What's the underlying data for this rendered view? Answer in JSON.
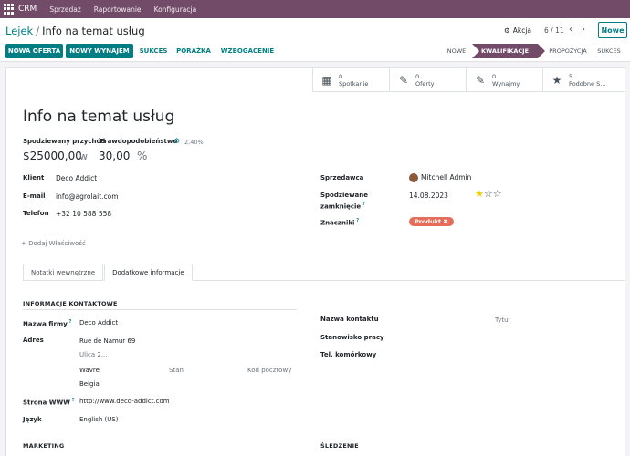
{
  "navbar": {
    "app_name": "CRM",
    "menus": [
      "Sprzedaż",
      "Raportowanie",
      "Konfiguracja"
    ]
  },
  "control_panel": {
    "breadcrumb_parent": "Lejek",
    "breadcrumb_current": "Info na temat usług",
    "action_label": "Akcja",
    "pager": "6 / 11",
    "new_button": "Nowe"
  },
  "statusbar": {
    "buttons": {
      "new_quote": "NOWA OFERTA",
      "new_rental": "NOWY WYNAJEM",
      "won": "SUKCES",
      "lost": "PORAŻKA",
      "enrich": "WZBOGACENIE"
    },
    "stages": [
      "NOWE",
      "KWALIFIKACJE",
      "PROPOZYCJA",
      "SUKCES"
    ],
    "active_stage": "KWALIFIKACJE"
  },
  "smart_buttons": [
    {
      "icon": "calendar-icon",
      "count": "0",
      "label": "Spotkanie"
    },
    {
      "icon": "edit-icon",
      "count": "0",
      "label": "Oferty"
    },
    {
      "icon": "edit-icon",
      "count": "0",
      "label": "Wynajmy"
    },
    {
      "icon": "star-icon",
      "count": "5",
      "label": "Podobne S..."
    }
  ],
  "form": {
    "title": "Info na temat usług",
    "expected_revenue_label": "Spodziewany przychód",
    "probability_label": "Prawdopodobieństwo",
    "auto_probability": "2,40%",
    "expected_revenue": "$25000,00",
    "w_label": "w",
    "probability": "30,00",
    "percent": "%",
    "left": {
      "client_label": "Klient",
      "client_value": "Deco Addict",
      "email_label": "E-mail",
      "email_value": "info@agrolait.com",
      "phone_label": "Telefon",
      "phone_value": "+32 10 588 558"
    },
    "right": {
      "salesperson_label": "Sprzedawca",
      "salesperson_value": "Mitchell Admin",
      "closing_label_1": "Spodziewane",
      "closing_label_2": "zamknięcie",
      "closing_value": "14.08.2023",
      "tags_label": "Znaczniki",
      "tag": "Produkt"
    },
    "add_property": "Dodaj Właściwość",
    "priority_stars": 1
  },
  "tabs": {
    "internal_notes": "Notatki wewnętrzne",
    "extra_info": "Dodatkowe informacje",
    "active": "extra_info"
  },
  "extra": {
    "contact_section": "INFORMACJE KONTAKTOWE",
    "company_label": "Nazwa firmy",
    "company_value": "Deco Addict",
    "address_label": "Adres",
    "street": "Rue de Namur 69",
    "street2_placeholder": "Ulica 2...",
    "city": "Wavre",
    "state_placeholder": "Stan",
    "zip_placeholder": "Kod pocztowy",
    "country": "Belgia",
    "website_label": "Strona WWW",
    "website_value": "http://www.deco-addict.com",
    "language_label": "Język",
    "language_value": "English (US)",
    "contact_name_label": "Nazwa kontaktu",
    "contact_title_placeholder": "Tytuł",
    "job_label": "Stanowisko pracy",
    "mobile_label": "Tel. komórkowy",
    "marketing_section": "MARKETING",
    "tracking_section": "ŚLEDZENIE"
  },
  "colors": {
    "brand": "#714B67",
    "accent": "#017e84",
    "tag": "#e56e5a",
    "star": "#f3cc00"
  }
}
